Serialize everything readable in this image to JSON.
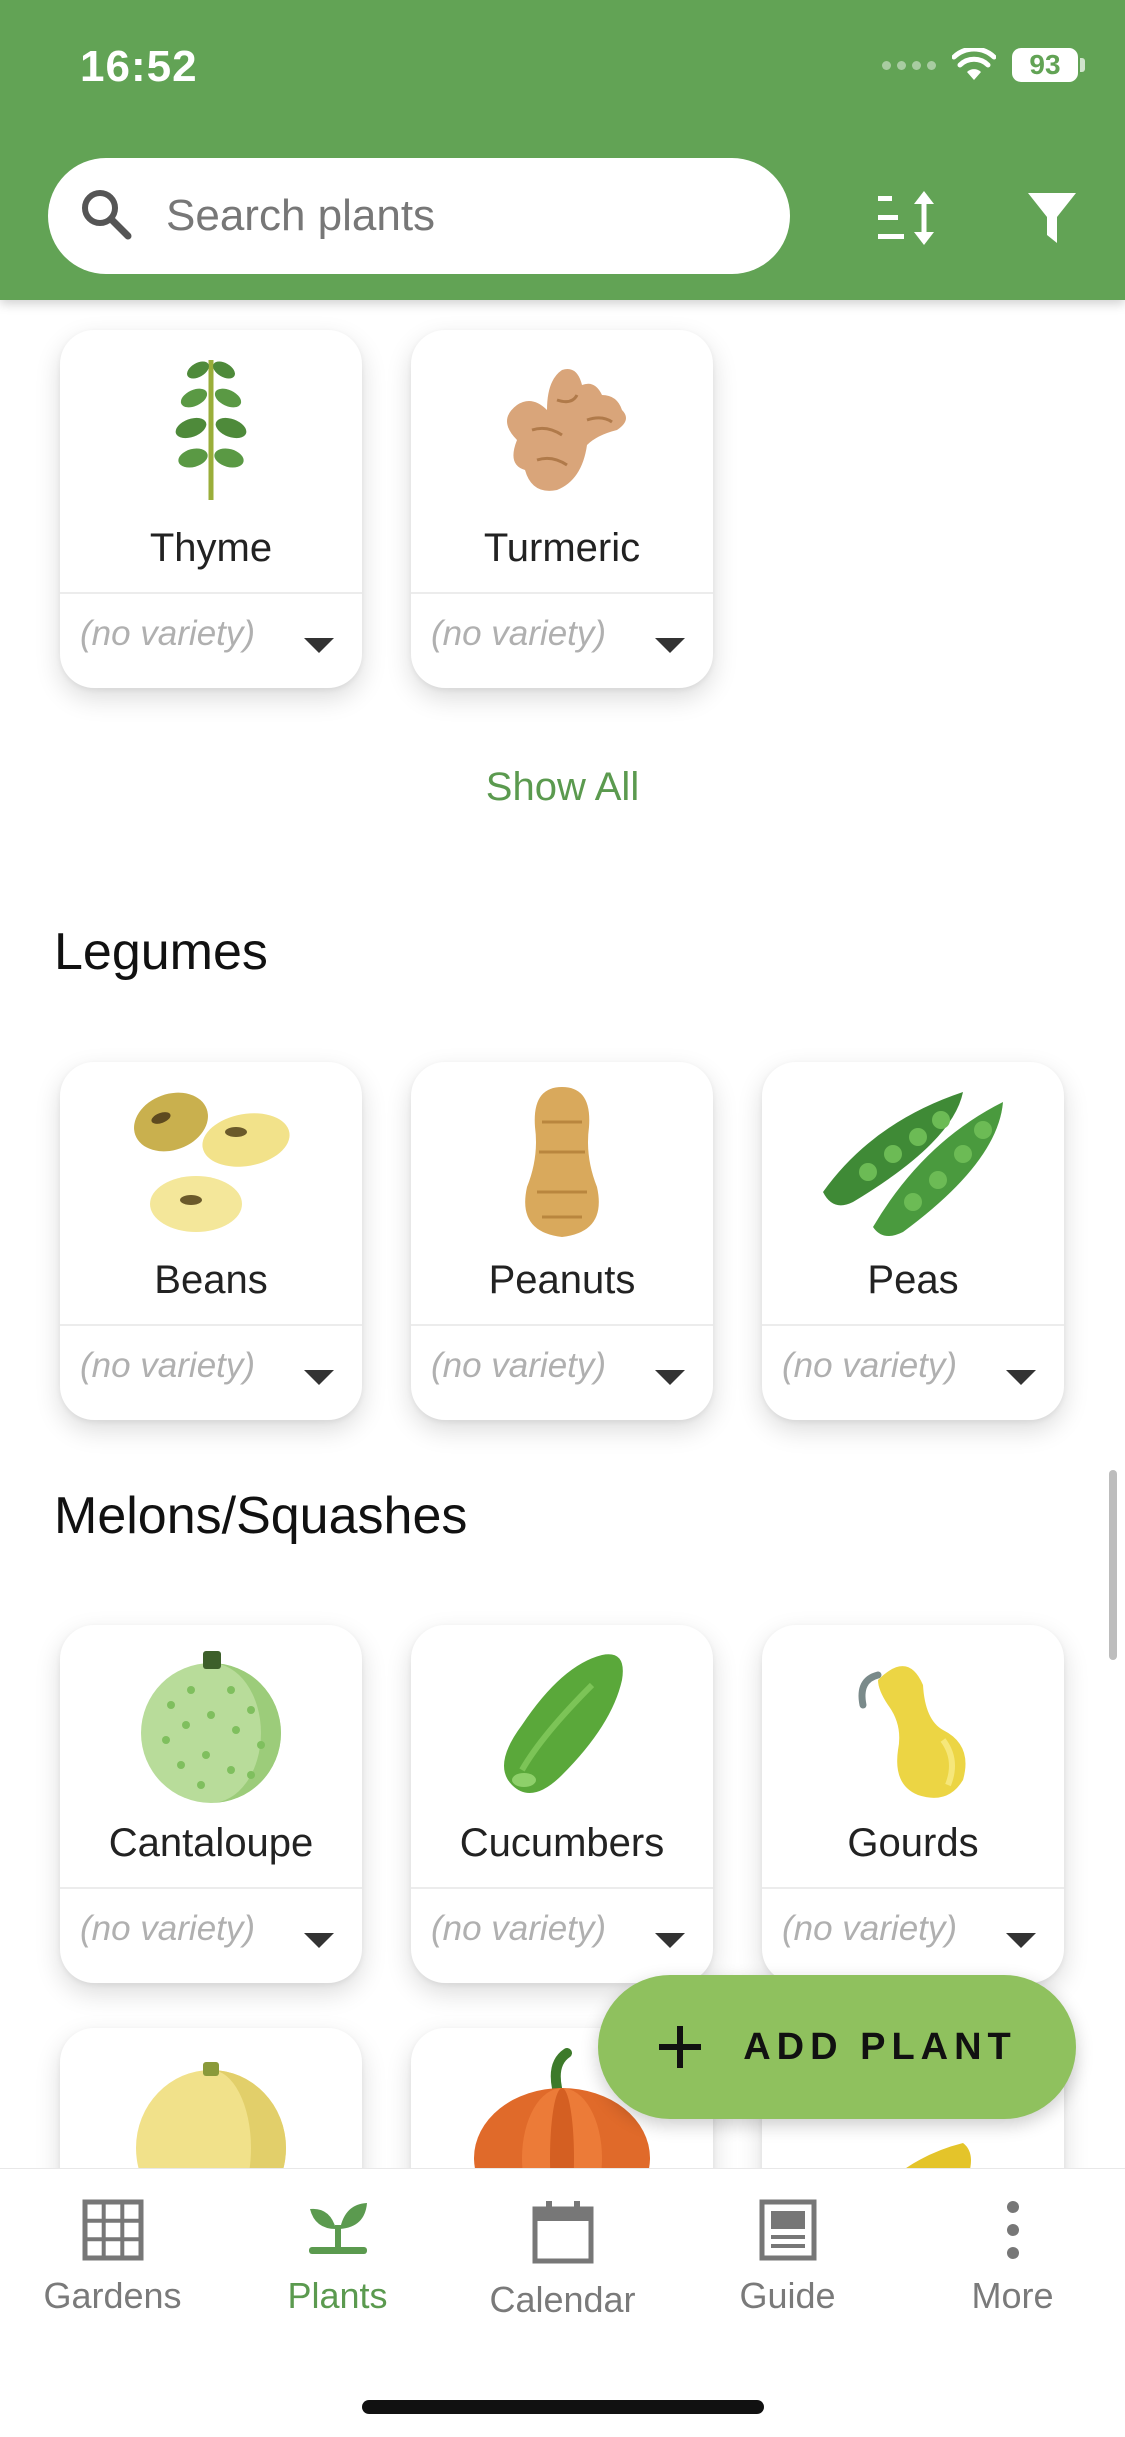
{
  "status_bar": {
    "time": "16:52",
    "battery": "93"
  },
  "search": {
    "placeholder": "Search plants"
  },
  "herbs_tail": [
    {
      "name": "Thyme",
      "variety": "(no variety)"
    },
    {
      "name": "Turmeric",
      "variety": "(no variety)"
    }
  ],
  "show_all_label": "Show All",
  "sections": {
    "legumes": {
      "title": "Legumes",
      "plants": [
        {
          "name": "Beans",
          "variety": "(no variety)"
        },
        {
          "name": "Peanuts",
          "variety": "(no variety)"
        },
        {
          "name": "Peas",
          "variety": "(no variety)"
        }
      ]
    },
    "melons": {
      "title": "Melons/Squashes",
      "plants": [
        {
          "name": "Cantaloupe",
          "variety": "(no variety)"
        },
        {
          "name": "Cucumbers",
          "variety": "(no variety)"
        },
        {
          "name": "Gourds",
          "variety": "(no variety)"
        }
      ]
    }
  },
  "fab": {
    "label": "ADD PLANT"
  },
  "nav": [
    {
      "label": "Gardens",
      "icon": "grid-icon"
    },
    {
      "label": "Plants",
      "icon": "sprout-icon",
      "active": true
    },
    {
      "label": "Calendar",
      "icon": "calendar-icon"
    },
    {
      "label": "Guide",
      "icon": "guide-icon"
    },
    {
      "label": "More",
      "icon": "more-icon"
    }
  ],
  "colors": {
    "primary": "#62a355",
    "accent": "#8fc15e",
    "link": "#5b9a4f"
  }
}
